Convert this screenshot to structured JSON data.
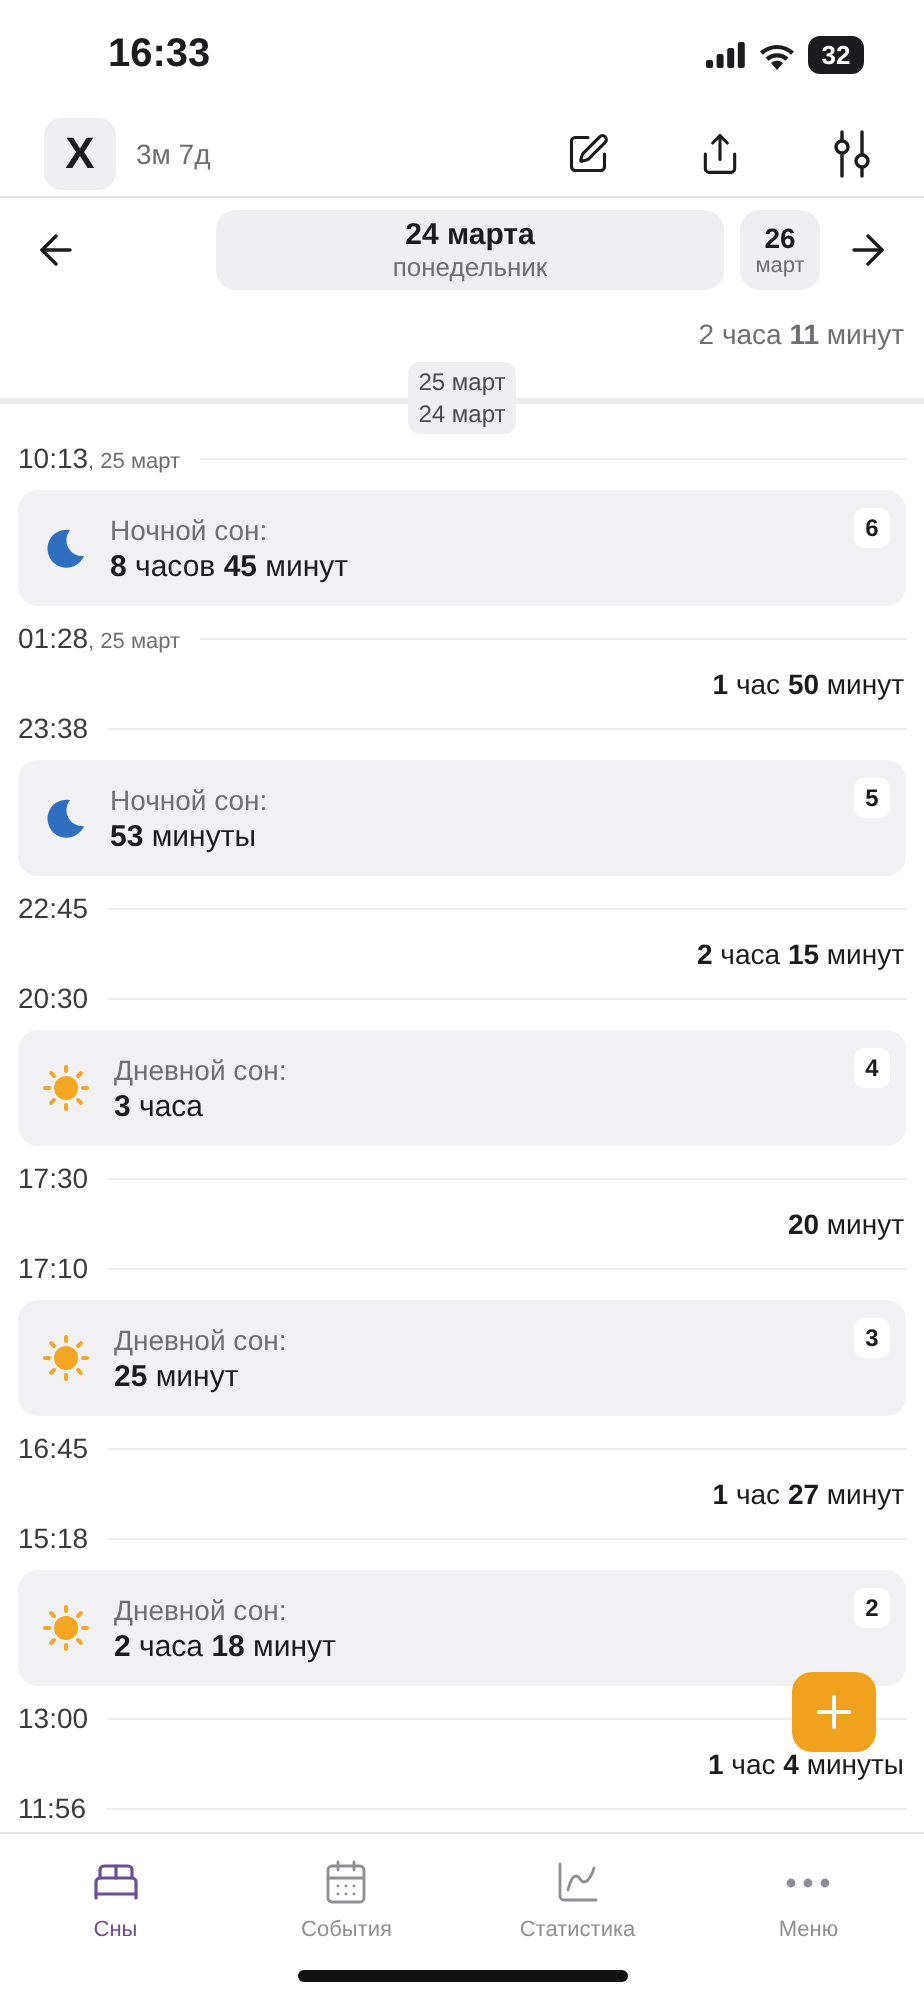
{
  "status_bar": {
    "time": "16:33",
    "battery": "32"
  },
  "header": {
    "close_label": "X",
    "age": "3м 7д"
  },
  "date_nav": {
    "current_date": "24 марта",
    "current_weekday": "понедельник",
    "next_day": "26",
    "next_month": "март"
  },
  "timeline": [
    {
      "kind": "gap",
      "text": "2 часа **11** минут",
      "muted": true
    },
    {
      "kind": "day_divider",
      "lines": [
        "25 март",
        "24 март"
      ]
    },
    {
      "kind": "time",
      "time": "10:13",
      "date": ", 25 март"
    },
    {
      "kind": "night_sleep",
      "label": "Ночной сон:",
      "duration": "**8** часов **45** минут",
      "number": "6"
    },
    {
      "kind": "time",
      "time": "01:28",
      "date": ", 25 март"
    },
    {
      "kind": "gap",
      "text": "**1** час **50** минут",
      "muted": false
    },
    {
      "kind": "time",
      "time": "23:38"
    },
    {
      "kind": "night_sleep",
      "label": "Ночной сон:",
      "duration": "**53** минуты",
      "number": "5"
    },
    {
      "kind": "time",
      "time": "22:45"
    },
    {
      "kind": "gap",
      "text": "**2** часа **15** минут",
      "muted": false
    },
    {
      "kind": "time",
      "time": "20:30"
    },
    {
      "kind": "day_sleep",
      "label": "Дневной сон:",
      "duration": "**3** часа",
      "number": "4"
    },
    {
      "kind": "time",
      "time": "17:30"
    },
    {
      "kind": "gap",
      "text": "**20** минут",
      "muted": false
    },
    {
      "kind": "time",
      "time": "17:10"
    },
    {
      "kind": "day_sleep",
      "label": "Дневной сон:",
      "duration": "**25** минут",
      "number": "3"
    },
    {
      "kind": "time",
      "time": "16:45"
    },
    {
      "kind": "gap",
      "text": "**1** час **27** минут",
      "muted": false
    },
    {
      "kind": "time",
      "time": "15:18"
    },
    {
      "kind": "day_sleep",
      "label": "Дневной сон:",
      "duration": "**2** часа **18** минут",
      "number": "2"
    },
    {
      "kind": "time",
      "time": "13:00"
    },
    {
      "kind": "gap",
      "text": "**1** час **4** минуты",
      "muted": false
    },
    {
      "kind": "time",
      "time": "11:56"
    }
  ],
  "tab_bar": [
    {
      "kind": "bed",
      "label": "Сны",
      "selected": true
    },
    {
      "kind": "calendar",
      "label": "События",
      "selected": false
    },
    {
      "kind": "chart",
      "label": "Статистика",
      "selected": false
    },
    {
      "kind": "more",
      "label": "Меню",
      "selected": false
    }
  ]
}
